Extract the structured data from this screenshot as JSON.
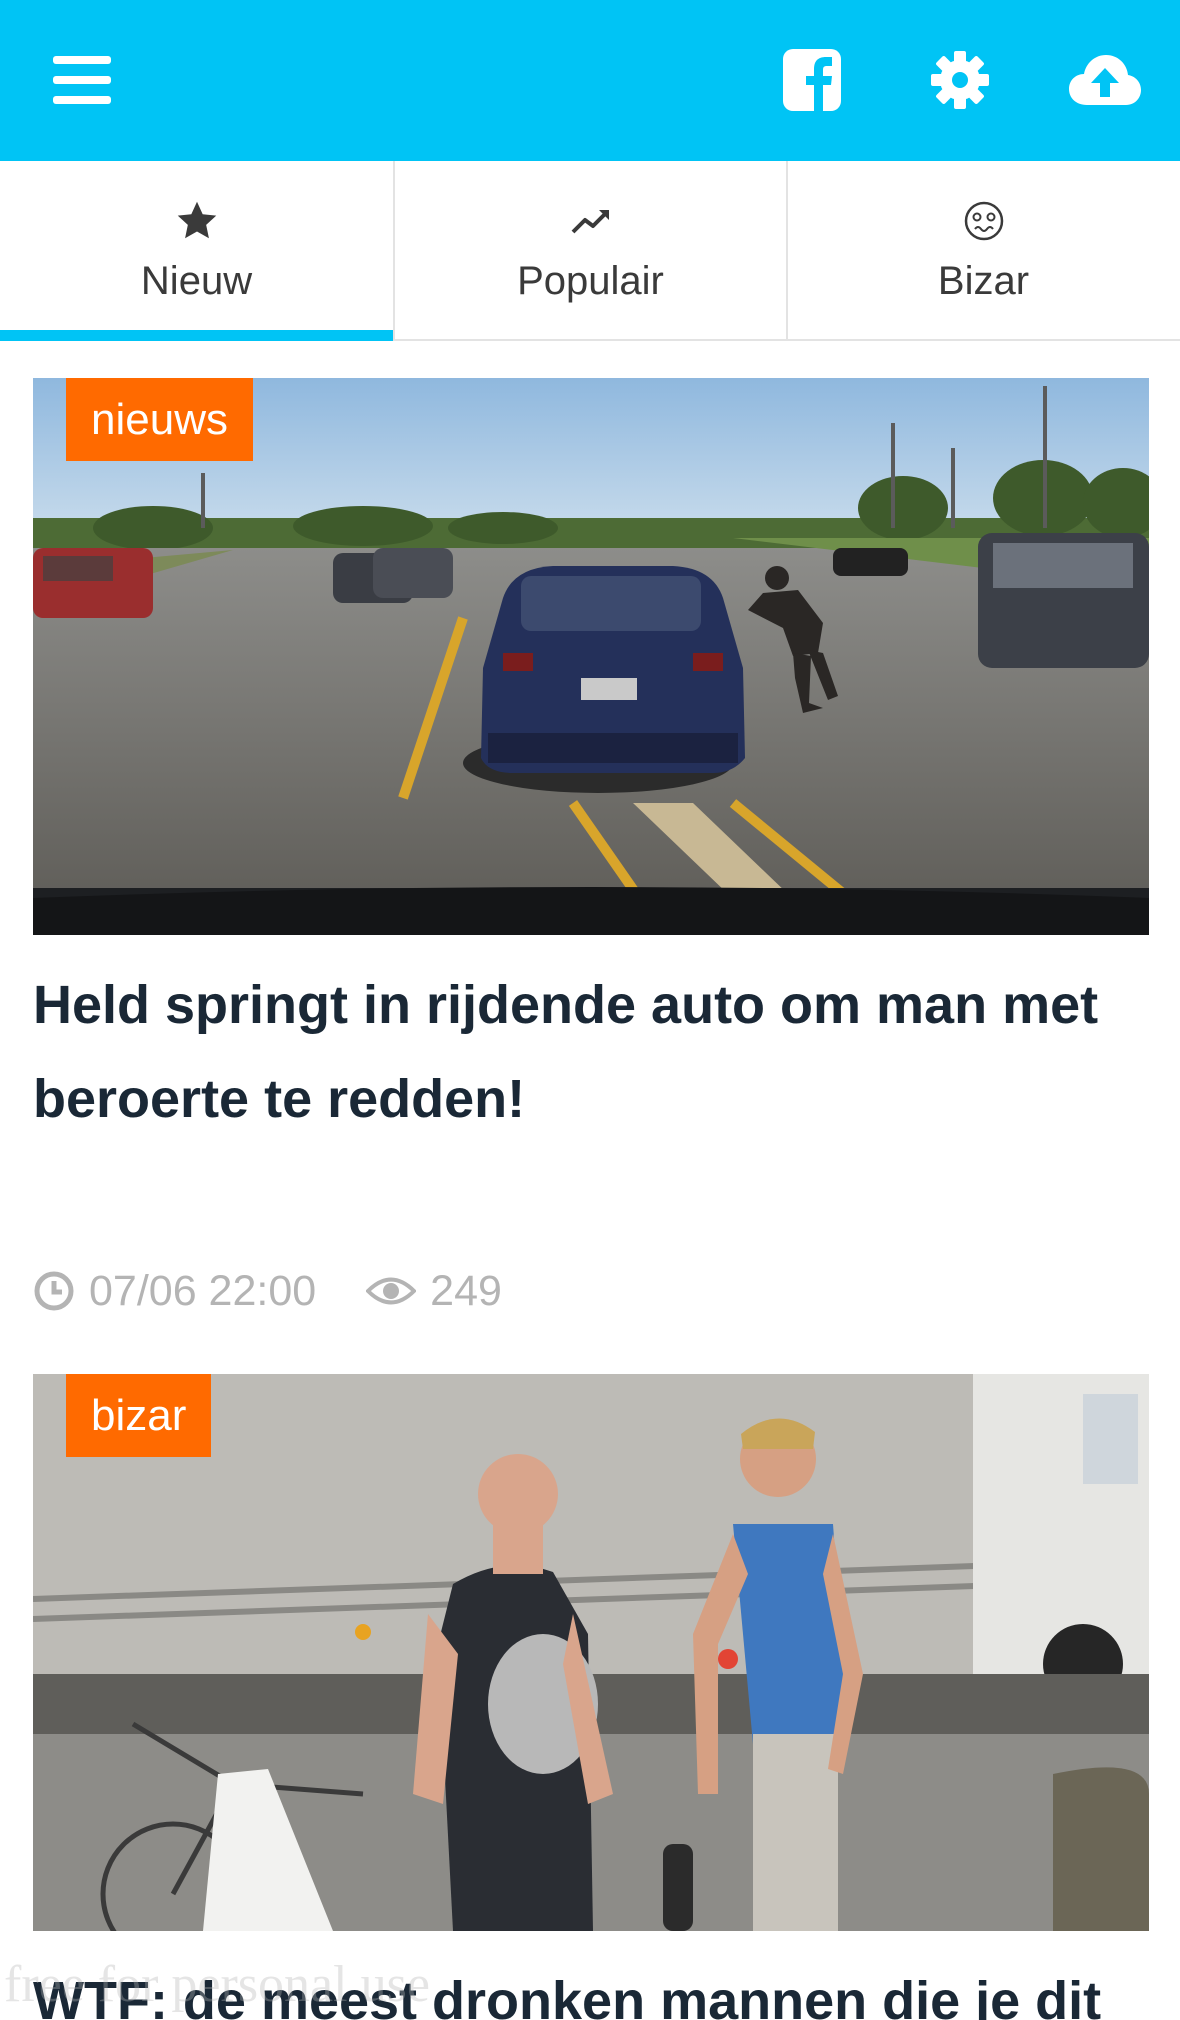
{
  "header": {
    "menu_icon": "hamburger-menu-icon",
    "facebook_icon": "facebook-icon",
    "settings_icon": "gear-icon",
    "upload_icon": "cloud-upload-icon",
    "background_color": "#00c4f5"
  },
  "tabs": [
    {
      "label": "Nieuw",
      "icon": "star-icon",
      "active": true
    },
    {
      "label": "Populair",
      "icon": "trending-up-icon",
      "active": false
    },
    {
      "label": "Bizar",
      "icon": "dizzy-face-icon",
      "active": false
    }
  ],
  "articles": [
    {
      "category": "nieuws",
      "title": "Held springt in rijdende auto om man met beroerte te redden!",
      "time": "07/06 22:00",
      "views": "249",
      "image": "dashcam-road-car-man-photo"
    },
    {
      "category": "bizar",
      "title": "WTF: de meest dronken mannen die je dit",
      "image": "two-men-bicycle-truck-photo"
    }
  ],
  "watermark": "free for personal use",
  "colors": {
    "accent": "#00c4f5",
    "badge": "#ff6a00",
    "title_text": "#1a2836",
    "meta_text": "#b4b4b4"
  }
}
